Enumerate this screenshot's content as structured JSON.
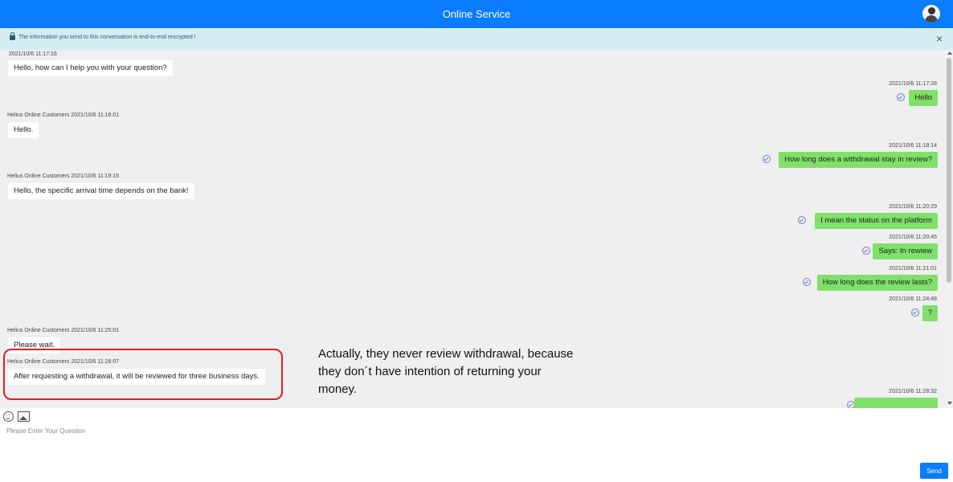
{
  "header": {
    "title": "Online Service",
    "avatar_icon": "user-avatar-icon",
    "color": "#0a7cff"
  },
  "notice": {
    "icon": "lock-icon",
    "text": "The information you send to this conversation is end-to-end encrypted !",
    "close_symbol": "×"
  },
  "messages": [
    {
      "side": "left",
      "meta": "2021/10/6 11:17:16",
      "text": "Hello, how can I help you with your question?"
    },
    {
      "side": "right",
      "meta": "2021/10/6 11:17:28",
      "text": "Hello",
      "status_icon": "read-check-icon"
    },
    {
      "side": "left",
      "meta": "Helius Online Customers 2021/10/6 11:18:01",
      "text": "Hello."
    },
    {
      "side": "right",
      "meta": "2021/10/6 11:18:14",
      "text": "How long does a withdrawal stay in review?",
      "status_icon": "read-check-icon"
    },
    {
      "side": "left",
      "meta": "Helius Online Customers 2021/10/6 11:19:15",
      "text": "Hello, the specific arrival time depends on the bank!"
    },
    {
      "side": "right",
      "meta": "2021/10/6 11:20:29",
      "text": "I mean the status on the platform",
      "status_icon": "read-check-icon"
    },
    {
      "side": "right",
      "meta": "2021/10/6 11:20:45",
      "text": "Says: In rewiew",
      "status_icon": "read-check-icon"
    },
    {
      "side": "right",
      "meta": "2021/10/6 11:21:01",
      "text": "How long does the review lasts?",
      "status_icon": "read-check-icon"
    },
    {
      "side": "right",
      "meta": "2021/10/6 11:24:48",
      "text": "?",
      "status_icon": "read-check-icon"
    },
    {
      "side": "left",
      "meta": "Helius Online Customers 2021/10/6 11:25:01",
      "text": "Please wait."
    },
    {
      "side": "left",
      "meta": "Helius Online Customers 2021/10/6 11:28:07",
      "text": "After requesting a withdrawal, it will be reviewed for three business days."
    },
    {
      "side": "right",
      "meta": "2021/10/6 11:28:32",
      "text": "",
      "status_icon": "read-check-icon"
    }
  ],
  "annotation": {
    "text": "Actually, they never review withdrawal, because they don´t have intention of returning your money.",
    "highlight_color": "#e01b24"
  },
  "composer": {
    "emoji_icon": "emoji-icon",
    "image_icon": "image-icon",
    "placeholder": "Please Enter Your Question",
    "value": "",
    "send_label": "Send"
  },
  "colors": {
    "user_bubble": "#7fe06a",
    "agent_bubble": "#ffffff",
    "chat_background": "#efefef",
    "notice_background": "#d4edf3"
  }
}
